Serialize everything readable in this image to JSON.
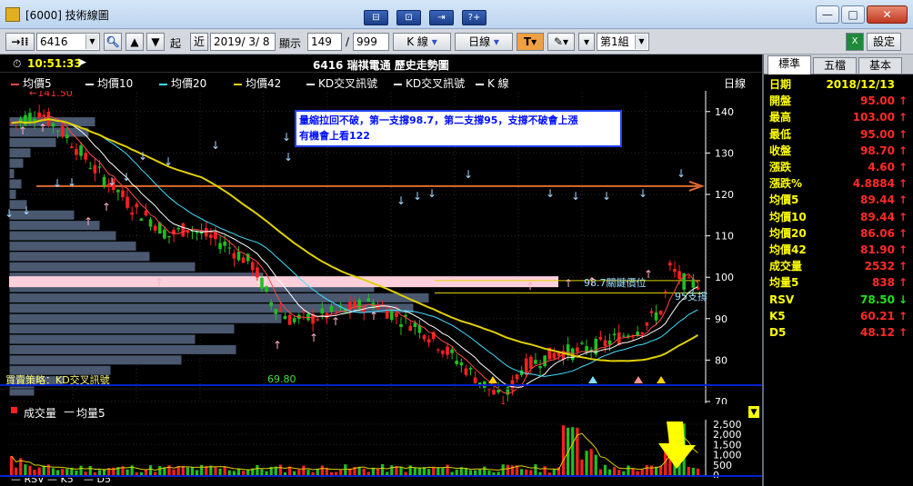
{
  "window": {
    "title": "[6000] 技術線圖",
    "mid_buttons": [
      "⊟",
      "⊡",
      "⇥",
      "?+"
    ],
    "caption": {
      "minimize": "—",
      "maximize": "□",
      "close": "✕"
    }
  },
  "toolbar": {
    "code": "6416",
    "start_label": "起",
    "near_label": "近",
    "date": "2019/ 3/ 8",
    "display_label": "顯示",
    "display_count": "149",
    "slash": "/",
    "display_max": "999",
    "chart_type": "K 線",
    "period": "日線",
    "tool_t": "T",
    "group": "第1組",
    "settings_label": "設定"
  },
  "chart": {
    "time": "10:51:33",
    "title": "6416 瑞祺電通  歷史走勢圖",
    "period_label": "日線",
    "legend": [
      {
        "label": "均價5",
        "color": "#ff4848"
      },
      {
        "label": "均價10",
        "color": "#ffffff"
      },
      {
        "label": "均價20",
        "color": "#40e0ff"
      },
      {
        "label": "均價42",
        "color": "#e0d000"
      },
      {
        "label": "KD交叉訊號",
        "color": "#ffffff"
      },
      {
        "label": "KD交叉訊號",
        "color": "#ffffff"
      },
      {
        "label": "K 線",
        "color": "#ffffff"
      }
    ],
    "annotation_line1": "量縮拉回不破，第一支撐98.7，第二支撐95，支撐不破會上漲",
    "annotation_line2": "有機會上看122",
    "high_mark": "141.50",
    "low_mark": "69.80",
    "key_level_label": "98.7關鍵價位",
    "support_label": "95支撐",
    "strategy_label": "買賣策略：KD交叉訊號",
    "price_ticks": [
      "140",
      "130",
      "120",
      "110",
      "100",
      "90",
      "80",
      "70"
    ],
    "volume_label": "成交量",
    "volume_ma_label": "均量5",
    "volume_ticks": [
      "2,500",
      "2,000",
      "1,500",
      "1,000",
      "500",
      "0"
    ],
    "bottom_legend": [
      "RSV",
      "K5",
      "D5"
    ]
  },
  "chart_data": {
    "type": "candlestick",
    "price_axis": {
      "min": 70,
      "max": 142,
      "ticks": [
        70,
        80,
        90,
        100,
        110,
        120,
        130,
        140
      ]
    },
    "volume_axis": {
      "min": 0,
      "max": 2500,
      "ticks": [
        0,
        500,
        1000,
        1500,
        2000,
        2500
      ]
    },
    "key_level": 98.7,
    "support": 95,
    "target": 122,
    "high": 141.5,
    "low": 69.8,
    "colors": {
      "up": "#ff2020",
      "down": "#20c020",
      "ma5": "#ff4848",
      "ma10": "#ffffff",
      "ma20": "#40e0ff",
      "ma42": "#e0d000",
      "vol_profile": "#4a5870",
      "key_band": "#ffd0dc",
      "target_line": "#e06a30"
    }
  },
  "quote": {
    "tabs": [
      "標準",
      "五檔",
      "基本"
    ],
    "rows": [
      {
        "label": "日期",
        "value": "2018/12/13",
        "color": "yellow",
        "arrow": ""
      },
      {
        "label": "開盤",
        "value": "95.00",
        "color": "red",
        "arrow": "↑"
      },
      {
        "label": "最高",
        "value": "103.00",
        "color": "red",
        "arrow": "↑"
      },
      {
        "label": "最低",
        "value": "95.00",
        "color": "red",
        "arrow": "↑"
      },
      {
        "label": "收盤",
        "value": "98.70",
        "color": "red",
        "arrow": "↑"
      },
      {
        "label": "漲跌",
        "value": "4.60",
        "color": "red",
        "arrow": "↑"
      },
      {
        "label": "漲跌%",
        "value": "4.8884",
        "color": "red",
        "arrow": "↑"
      },
      {
        "label": "均價5",
        "value": "89.44",
        "color": "red",
        "arrow": "↑"
      },
      {
        "label": "均價10",
        "value": "89.44",
        "color": "red",
        "arrow": "↑"
      },
      {
        "label": "均價20",
        "value": "86.06",
        "color": "red",
        "arrow": "↑"
      },
      {
        "label": "均價42",
        "value": "81.90",
        "color": "red",
        "arrow": "↑"
      },
      {
        "label": "成交量",
        "value": "2532",
        "color": "red",
        "arrow": "↑"
      },
      {
        "label": "均量5",
        "value": "838",
        "color": "red",
        "arrow": "↑"
      },
      {
        "label": "RSV",
        "value": "78.50",
        "color": "green",
        "arrow": "↓"
      },
      {
        "label": "K5",
        "value": "60.21",
        "color": "red",
        "arrow": "↑"
      },
      {
        "label": "D5",
        "value": "48.12",
        "color": "red",
        "arrow": "↑"
      }
    ]
  }
}
